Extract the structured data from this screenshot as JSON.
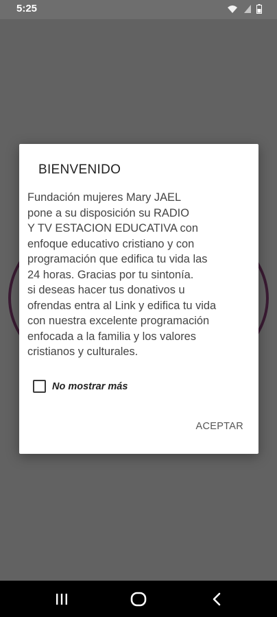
{
  "status_bar": {
    "time": "5:25",
    "icons": [
      "wifi-icon",
      "signal-icon",
      "battery-icon"
    ]
  },
  "dialog": {
    "title": "BIENVENIDO",
    "message": "Fundación mujeres Mary JAEL\npone a su disposición su RADIO\nY TV ESTACION EDUCATIVA con\nenfoque educativo cristiano y con\nprogramación que edifica tu vida las\n24 horas. Gracias por tu sintonía.\nsi deseas hacer tus donativos u\nofrendas entra al Link y edifica tu vida\ncon nuestra excelente programación\nenfocada a la familia y los valores\ncristianos y culturales.",
    "checkbox_label": "No mostrar más",
    "checkbox_checked": false,
    "accept_label": "ACEPTAR"
  },
  "nav_bar": {
    "buttons": [
      "recents-icon",
      "home-icon",
      "back-icon"
    ]
  },
  "colors": {
    "scrim": "#626262",
    "dialog_bg": "#ffffff",
    "ring": "#3a1b33",
    "nav_bg": "#000000"
  }
}
